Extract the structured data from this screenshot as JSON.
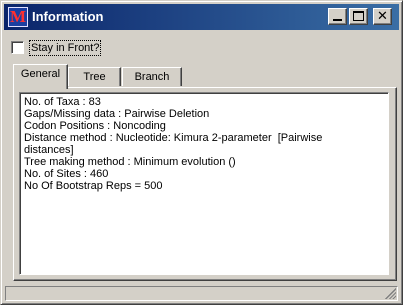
{
  "window": {
    "title": "Information",
    "icon": "mega-app-icon",
    "icon_letter": "M",
    "colors": {
      "titlebar_start": "#0a246a",
      "titlebar_end": "#3a6ea5",
      "face": "#d4d0c8",
      "icon_letter": "#ff3030"
    }
  },
  "toolbar": {
    "stay_in_front_label": "Stay in Front?",
    "stay_in_front_checked": false
  },
  "tabs": [
    {
      "label": "General",
      "active": true
    },
    {
      "label": "Tree",
      "active": false
    },
    {
      "label": "Branch",
      "active": false
    }
  ],
  "info": {
    "lines": [
      "No. of Taxa : 83",
      "Gaps/Missing data : Pairwise Deletion",
      "Codon Positions : Noncoding",
      "Distance method : Nucleotide: Kimura 2-parameter  [Pairwise",
      "distances]",
      "Tree making method : Minimum evolution ()",
      "No. of Sites : 460",
      "No Of Bootstrap Reps = 500"
    ]
  }
}
